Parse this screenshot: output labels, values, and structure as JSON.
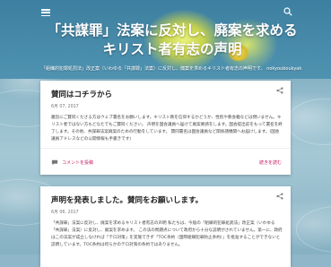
{
  "header": {
    "title": "「共謀罪」法案に反対し、廃案を求めるキリスト者有志の声明",
    "description": "「組織的犯罪処罰法」改正案（いわゆる「共謀罪」法案）に反対し、廃案を求めるキリスト者有志の声明です。 nokyouboukyakaejesus@gmail.com"
  },
  "posts": [
    {
      "title": "賛同はコチラから",
      "date": "6月 07, 2017",
      "body": "趣旨にご賛同くださる方はウェブ署名をお願いします。キリスト教を信仰するかどうか、性別や教会籍などは問いません。キリスト者ではない方もどなたでもご賛同ください。 声明を国会議員へ届けて廃案要請をします。国会提出前をもって署名を終了します。その他、共謀罪法案廃案のための行動をしています。 賛同署名は国会議員など関係諸機関へお届けします。(国会議員アドレスなどの公開情報も手書きです)",
      "ellipsis": "…",
      "comment_label": "コメントを投稿",
      "read_more_label": "続きを読む"
    },
    {
      "title": "声明を発表しました。賛同をお願いします。",
      "date": "6月 06, 2017",
      "body": "「共謀罪」法案に反対し、廃案を求めるキリスト者有志の声明 私たちは、今般の「組織的犯罪処罰法」改正案（いわゆる「共謀罪」法案）に反対し、廃案を求めます。 この法の問題点について政府から十分な説明がされていません。第一に、政府はこの法案が成立しなければ「テロ対策」を実施できず「TOC条約（国際組織犯罪防止条約）」を批准することができないと説明しています。TOC条約は何らかのテロ対策の条約ではありません。"
    }
  ]
}
